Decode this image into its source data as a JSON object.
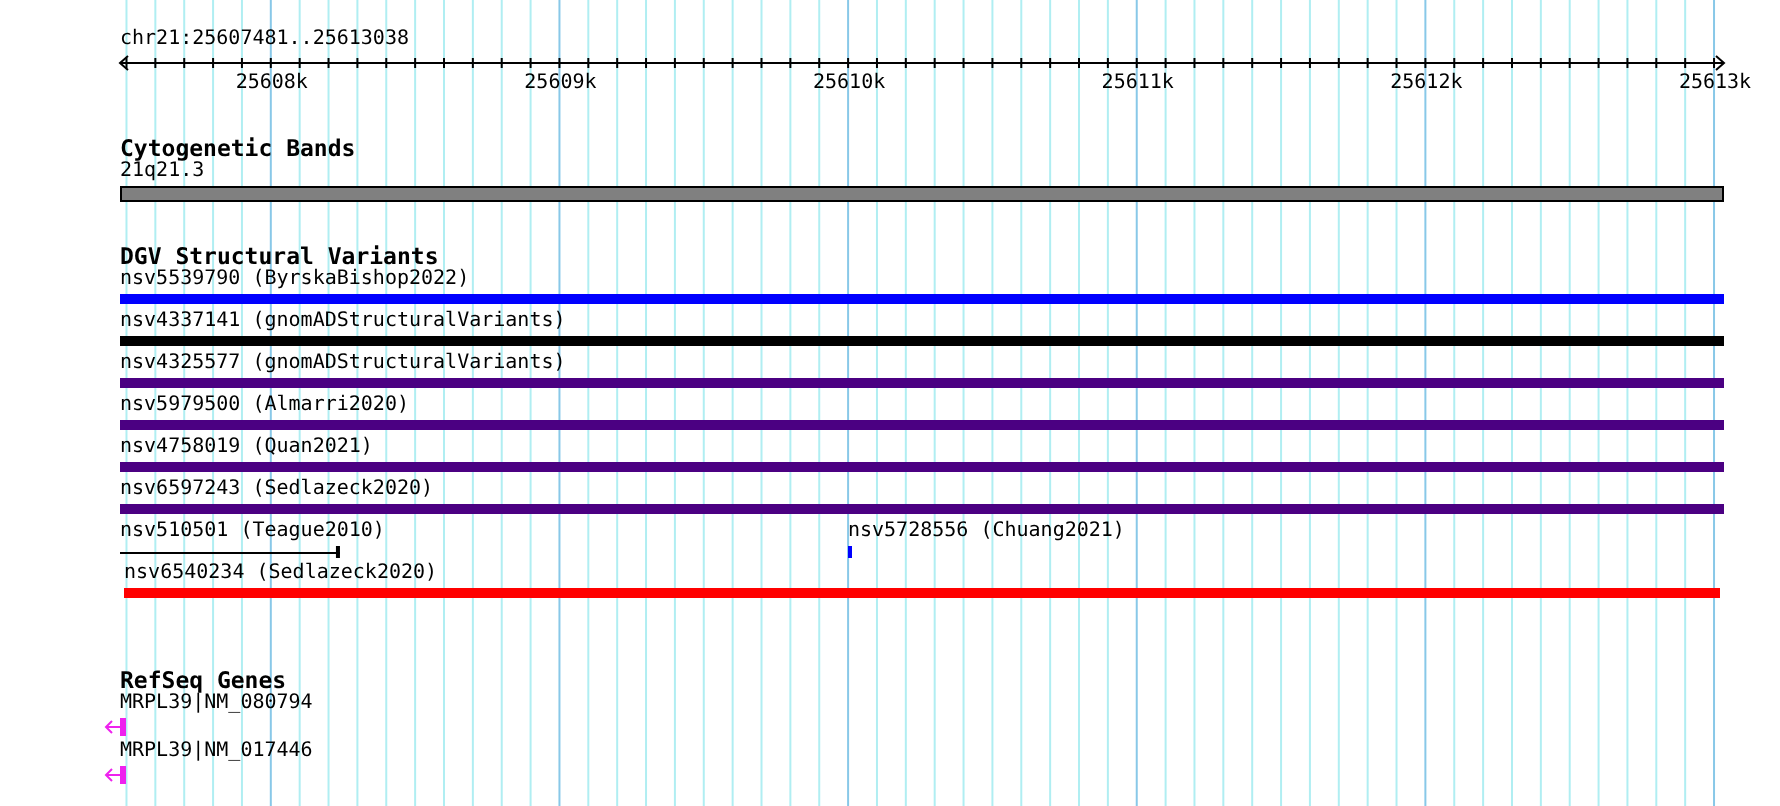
{
  "ruler": {
    "label": "chr21:25607481..25613038",
    "ticks": [
      "25608k",
      "25609k",
      "25610k",
      "25611k",
      "25612k",
      "25613k"
    ]
  },
  "cytobands": {
    "title": "Cytogenetic Bands",
    "band": {
      "label": "21q21.3"
    }
  },
  "variants": {
    "title": "DGV Structural Variants",
    "rows": [
      [
        {
          "label": "nsv5539790 (ByrskaBishop2022)",
          "kind": "bar",
          "color": "#0000ff"
        }
      ],
      [
        {
          "label": "nsv4337141 (gnomADStructuralVariants)",
          "kind": "bar",
          "color": "#000000"
        }
      ],
      [
        {
          "label": "nsv4325577 (gnomADStructuralVariants)",
          "kind": "bar",
          "color": "#4b0082"
        }
      ],
      [
        {
          "label": "nsv5979500 (Almarri2020)",
          "kind": "bar",
          "color": "#4b0082"
        }
      ],
      [
        {
          "label": "nsv4758019 (Quan2021)",
          "kind": "bar",
          "color": "#4b0082"
        }
      ],
      [
        {
          "label": "nsv6597243 (Sedlazeck2020)",
          "kind": "bar",
          "color": "#4b0082"
        }
      ],
      [
        {
          "label": "nsv510501 (Teague2010)",
          "kind": "span",
          "color": "#000000"
        },
        {
          "label": "nsv5728556 (Chuang2021)",
          "kind": "point",
          "color": "#0000ff"
        }
      ],
      [
        {
          "label": "nsv6540234 (Sedlazeck2020)",
          "kind": "bar",
          "color": "#ff0000"
        }
      ]
    ]
  },
  "genes": {
    "title": "RefSeq Genes",
    "items": [
      {
        "label": "MRPL39|NM_080794",
        "kind": "reverse"
      },
      {
        "label": "MRPL39|NM_017446",
        "kind": "reverse"
      }
    ]
  }
}
